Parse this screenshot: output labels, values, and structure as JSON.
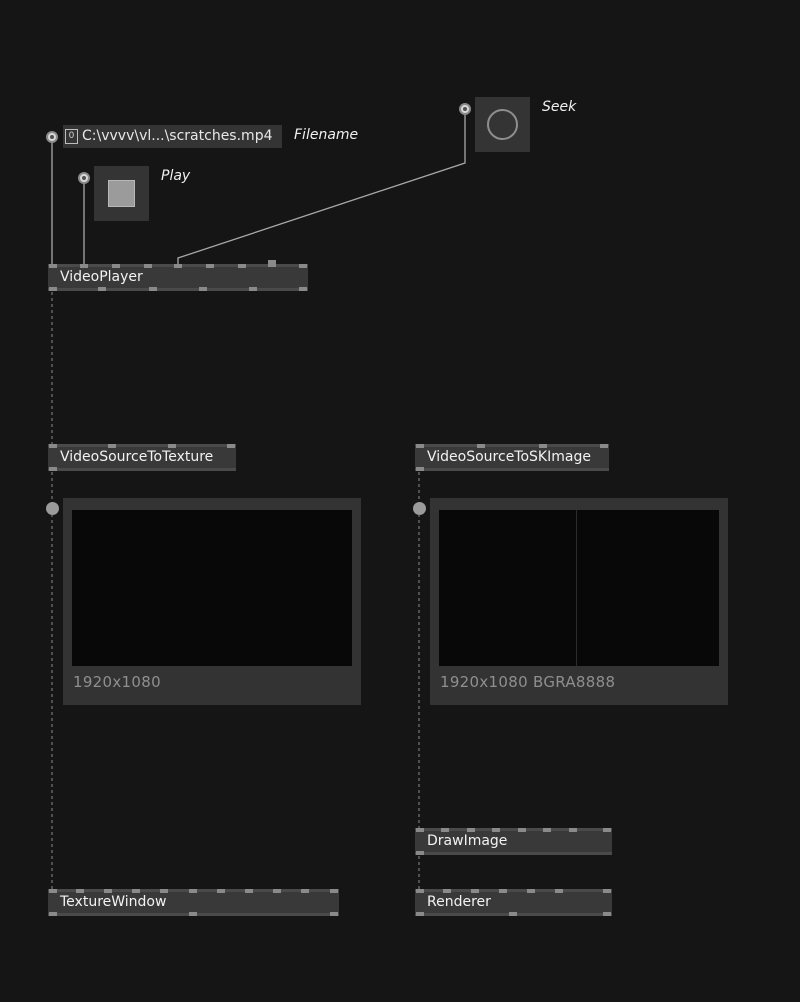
{
  "io": {
    "filename": {
      "index": "0",
      "value": "C:\\vvvv\\vl...\\scratches.mp4",
      "label": "Filename"
    },
    "play": {
      "label": "Play"
    },
    "seek": {
      "label": "Seek"
    }
  },
  "nodes": {
    "video_player": "VideoPlayer",
    "video_source_to_texture": "VideoSourceToTexture",
    "video_source_to_skimage": "VideoSourceToSKImage",
    "draw_image": "DrawImage",
    "texture_window": "TextureWindow",
    "renderer": "Renderer"
  },
  "previews": {
    "texture": {
      "caption": "1920x1080"
    },
    "skimage": {
      "caption": "1920x1080 BGRA8888"
    }
  },
  "colors": {
    "background": "#151515",
    "node": "#393939",
    "panel": "#333333",
    "wire": "#a8a8a8"
  }
}
